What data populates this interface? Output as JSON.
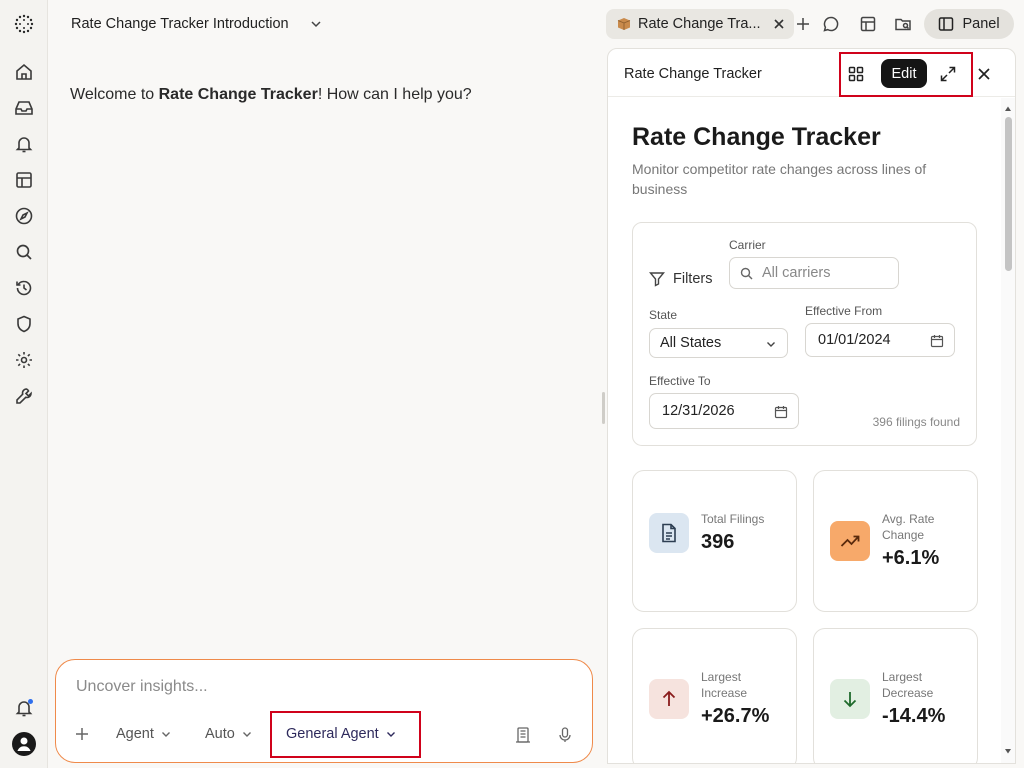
{
  "app": {
    "title": "Rate Change Tracker Introduction"
  },
  "rail": {
    "icons": [
      "logo-icon",
      "home-icon",
      "inbox-icon",
      "bell-icon",
      "layout-icon",
      "compass-icon",
      "search-icon",
      "history-icon",
      "shield-icon",
      "gear-icon",
      "wrench-icon",
      "notification-bell-icon",
      "user-avatar-icon"
    ]
  },
  "chat": {
    "welcome_prefix": "Welcome to ",
    "welcome_bold": "Rate Change Tracker",
    "welcome_suffix": "! How can I help you?",
    "composer_placeholder": "Uncover insights...",
    "agent_label": "Agent",
    "auto_label": "Auto",
    "general_agent_label": "General Agent"
  },
  "tabbar": {
    "tab_label": "Rate Change Tra...",
    "panel_label": "Panel"
  },
  "panel": {
    "header_title": "Rate Change Tracker",
    "edit_label": "Edit",
    "title": "Rate Change Tracker",
    "subtitle": "Monitor competitor rate changes across lines of business",
    "filters": {
      "title": "Filters",
      "carrier_label": "Carrier",
      "carrier_placeholder": "All carriers",
      "state_label": "State",
      "state_value": "All States",
      "effective_from_label": "Effective From",
      "effective_from_value": "01/01/2024",
      "effective_to_label": "Effective To",
      "effective_to_value": "12/31/2026",
      "found_text": "396 filings found"
    },
    "stats": [
      {
        "label": "Total Filings",
        "value": "396",
        "color": "#dbe6f1"
      },
      {
        "label": "Avg. Rate Change",
        "value": "+6.1%",
        "color": "#f7a96a"
      },
      {
        "label": "Largest Increase",
        "value": "+26.7%",
        "color": "#f6e3de"
      },
      {
        "label": "Largest Decrease",
        "value": "-14.4%",
        "color": "#e2efe2"
      }
    ]
  },
  "colors": {
    "accent_orange": "#ef8a4a",
    "highlight_red": "#d0021b",
    "notification_dot": "#2f6fed"
  }
}
